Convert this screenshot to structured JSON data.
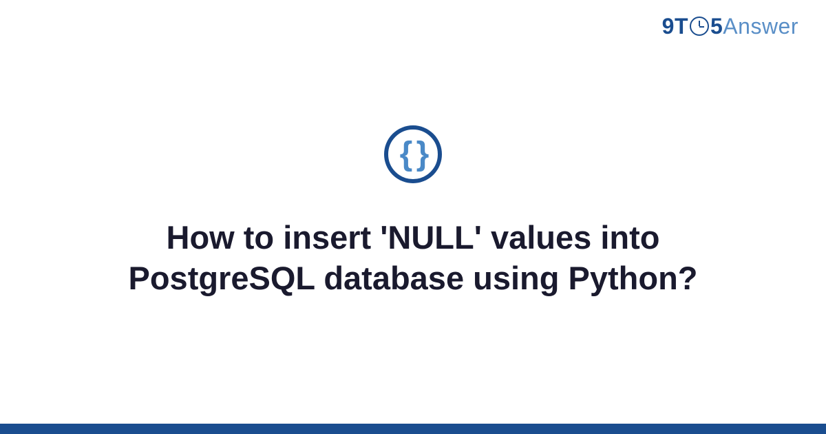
{
  "logo": {
    "prefix": "9T",
    "middle": "5",
    "suffix": "Answer"
  },
  "icon": {
    "braces": "{ }"
  },
  "title": "How to insert 'NULL' values into PostgreSQL database using Python?",
  "colors": {
    "primary": "#1a4d8f",
    "secondary": "#5a8fc7",
    "text": "#1a1a2e"
  }
}
